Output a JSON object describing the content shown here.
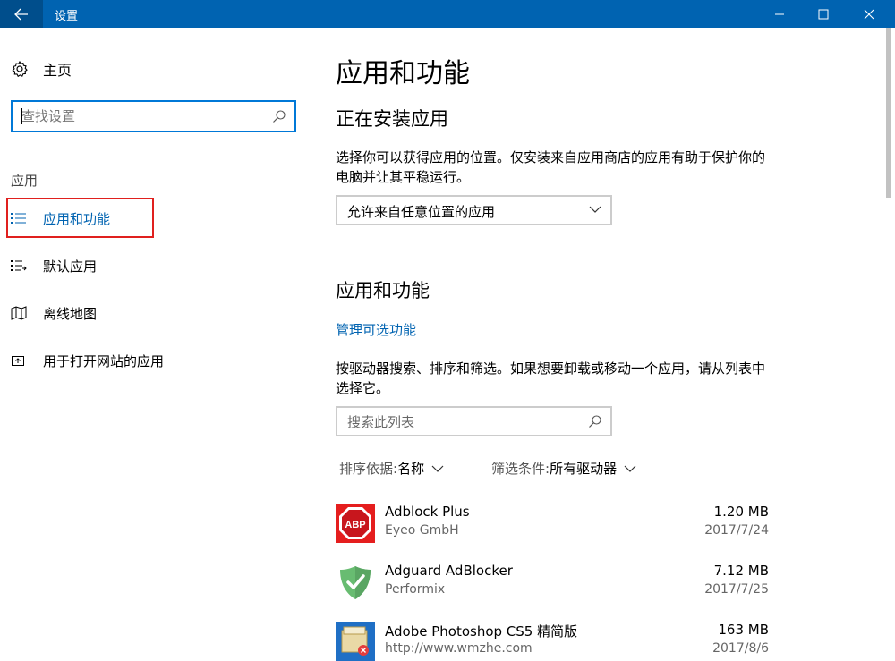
{
  "window": {
    "title": "设置"
  },
  "sidebar": {
    "home_label": "主页",
    "search_placeholder": "查找设置",
    "section_label": "应用",
    "items": [
      {
        "label": "应用和功能",
        "icon": "list-icon",
        "active": true
      },
      {
        "label": "默认应用",
        "icon": "default-apps-icon",
        "active": false
      },
      {
        "label": "离线地图",
        "icon": "map-icon",
        "active": false
      },
      {
        "label": "用于打开网站的应用",
        "icon": "open-web-icon",
        "active": false
      }
    ]
  },
  "main": {
    "title": "应用和功能",
    "install_heading": "正在安装应用",
    "install_desc": "选择你可以获得应用的位置。仅安装来自应用商店的应用有助于保护你的电脑并让其平稳运行。",
    "install_option": "允许来自任意位置的应用",
    "apps_heading": "应用和功能",
    "manage_link": "管理可选功能",
    "apps_desc": "按驱动器搜索、排序和筛选。如果想要卸载或移动一个应用，请从列表中选择它。",
    "list_search_placeholder": "搜索此列表",
    "sort_label": "排序依据:",
    "sort_value": "名称",
    "filter_label": "筛选条件:",
    "filter_value": "所有驱动器",
    "apps": [
      {
        "name": "Adblock Plus",
        "publisher": "Eyeo GmbH",
        "size": "1.20 MB",
        "date": "2017/7/24",
        "icon": "abp-icon"
      },
      {
        "name": "Adguard AdBlocker",
        "publisher": "Performix",
        "size": "7.12 MB",
        "date": "2017/7/25",
        "icon": "adguard-shield-icon"
      },
      {
        "name": "Adobe Photoshop CS5 精简版",
        "publisher": "http://www.wmzhe.com",
        "size": "163 MB",
        "date": "2017/8/6",
        "icon": "photoshop-installer-icon"
      }
    ]
  },
  "colors": {
    "accent": "#0063b1",
    "titlebar": "#0063b1",
    "highlight": "#e0201e"
  }
}
